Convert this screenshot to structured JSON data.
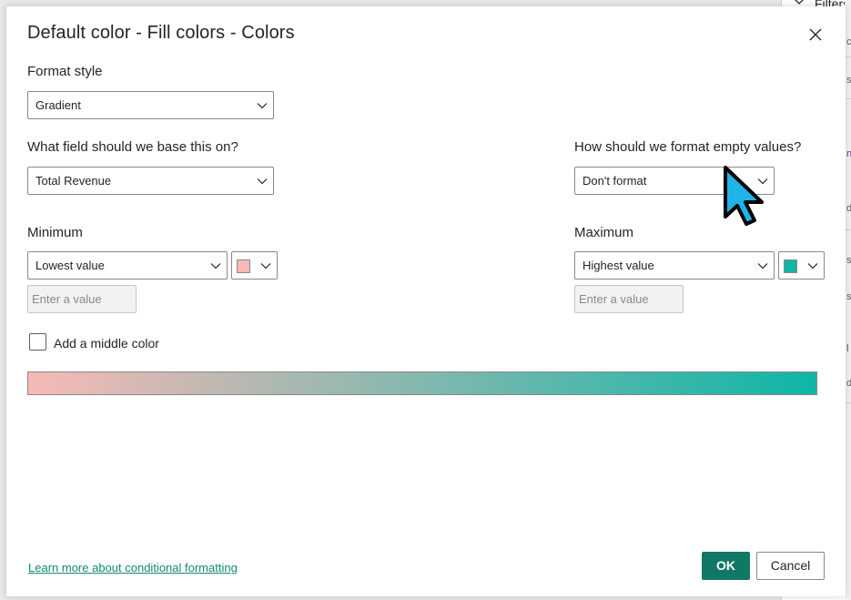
{
  "background": {
    "filters_label": "Filters",
    "fragments": [
      "c",
      "s",
      "n",
      "d",
      "s",
      "s",
      "l",
      "d"
    ]
  },
  "dialog": {
    "title": "Default color - Fill colors - Colors",
    "format_style": {
      "label": "Format style",
      "value": "Gradient"
    },
    "base_field": {
      "label": "What field should we base this on?",
      "value": "Total Revenue"
    },
    "empty_values": {
      "label": "How should we format empty values?",
      "value": "Don't format"
    },
    "minimum": {
      "label": "Minimum",
      "value": "Lowest value",
      "color": "#f7b9b6",
      "input_placeholder": "Enter a value"
    },
    "maximum": {
      "label": "Maximum",
      "value": "Highest value",
      "color": "#0db6a6",
      "input_placeholder": "Enter a value"
    },
    "middle_color": {
      "label": "Add a middle color",
      "checked": false
    },
    "gradient": {
      "from": "#f7b9b6",
      "to": "#0db6a6"
    },
    "learn_more_link": "Learn more about conditional formatting",
    "ok_label": "OK",
    "cancel_label": "Cancel"
  },
  "icons": {
    "close": "close-icon",
    "chevron": "chevron-down-icon",
    "cursor": "mouse-pointer-icon",
    "filter": "filter-icon"
  }
}
